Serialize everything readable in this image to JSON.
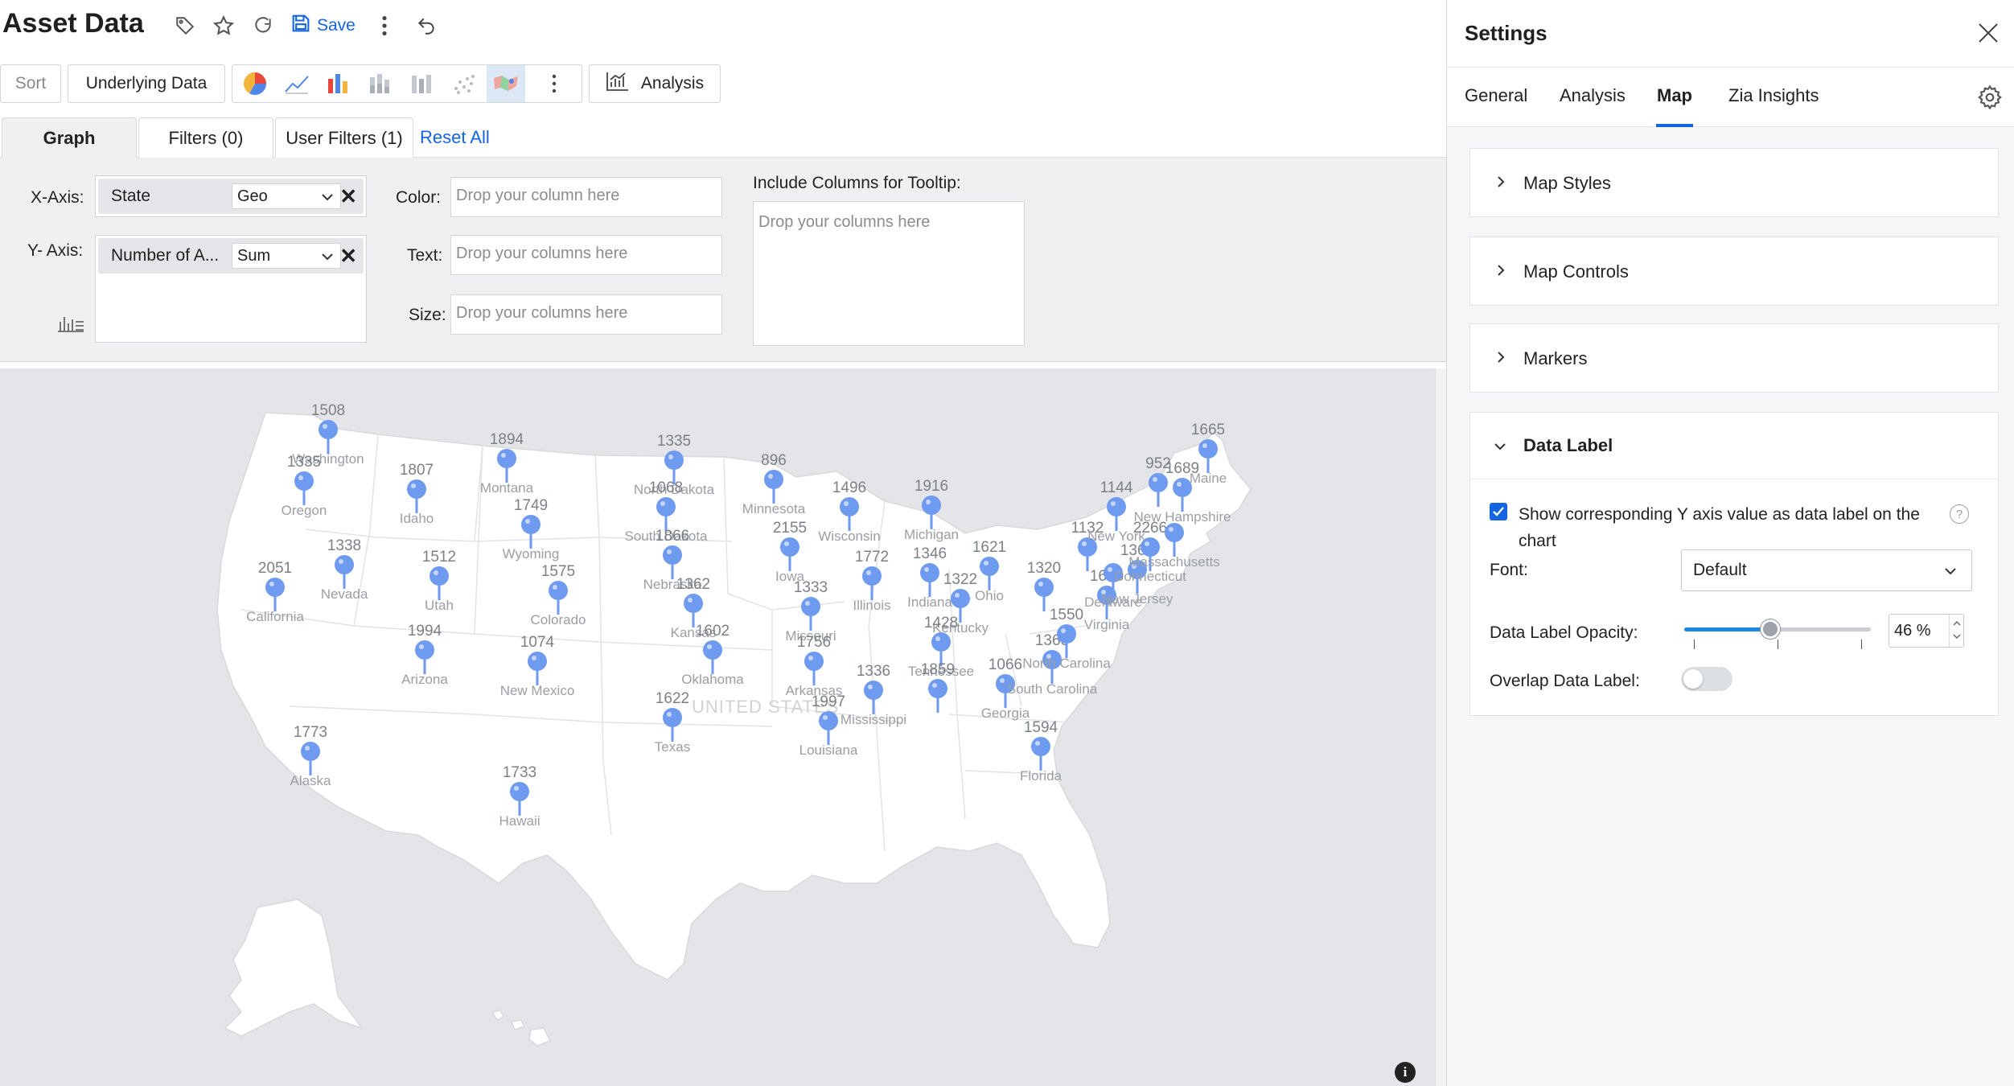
{
  "header": {
    "title": "Asset Data",
    "save_label": "Save"
  },
  "toolbar": {
    "sort_label": "Sort",
    "underlying_label": "Underlying Data",
    "analysis_label": "Analysis",
    "chart_types": [
      "pie-chart",
      "line-chart",
      "bar-chart",
      "stacked-bar-chart",
      "stacked-column-chart",
      "scatter-chart",
      "map-chart"
    ],
    "active_chart_type": "map-chart"
  },
  "tabs": {
    "graph": "Graph",
    "filters": "Filters  (0)",
    "user_filters": "User Filters  (1)",
    "reset_all": "Reset All"
  },
  "config": {
    "x_axis_label": "X-Axis:",
    "x_column": "State",
    "x_function": "Geo",
    "y_axis_label": "Y- Axis:",
    "y_column": "Number of A...",
    "y_function": "Sum",
    "color_label": "Color:",
    "color_placeholder": "Drop your column here",
    "text_label": "Text:",
    "text_placeholder": "Drop your columns here",
    "size_label": "Size:",
    "size_placeholder": "Drop your columns here",
    "tooltip_label": "Include Columns for Tooltip:",
    "tooltip_placeholder": "Drop your columns here"
  },
  "map": {
    "country_label": "UNITED STATES",
    "pin_color": "#6e9af0",
    "markers": [
      {
        "state": "Washington",
        "value": "1508"
      },
      {
        "state": "Oregon",
        "value": "1335"
      },
      {
        "state": "Montana",
        "value": "1894"
      },
      {
        "state": "Idaho",
        "value": "1807"
      },
      {
        "state": "North Dakota",
        "value": "1335"
      },
      {
        "state": "Minnesota",
        "value": "896"
      },
      {
        "state": "Wyoming",
        "value": "1749"
      },
      {
        "state": "South Dakota",
        "value": "1068"
      },
      {
        "state": "Wisconsin",
        "value": "1496"
      },
      {
        "state": "Michigan",
        "value": "1916"
      },
      {
        "state": "Nevada",
        "value": "1338"
      },
      {
        "state": "Utah",
        "value": "1512"
      },
      {
        "state": "California",
        "value": "2051"
      },
      {
        "state": "Colorado",
        "value": "1575"
      },
      {
        "state": "Nebraska",
        "value": "1866"
      },
      {
        "state": "Iowa",
        "value": "2155"
      },
      {
        "state": "Illinois",
        "value": "1772"
      },
      {
        "state": "Indiana",
        "value": "1346"
      },
      {
        "state": "Ohio",
        "value": "1621"
      },
      {
        "state": "Kansas",
        "value": "1362"
      },
      {
        "state": "Missouri",
        "value": "1333"
      },
      {
        "state": "Kentucky",
        "value": "1322"
      },
      {
        "state": "Arizona",
        "value": "1994"
      },
      {
        "state": "New Mexico",
        "value": "1074"
      },
      {
        "state": "Oklahoma",
        "value": "1602"
      },
      {
        "state": "Arkansas",
        "value": "1756"
      },
      {
        "state": "Tennessee",
        "value": "1428"
      },
      {
        "state": "Texas",
        "value": "1622"
      },
      {
        "state": "Mississippi",
        "value": "1336"
      },
      {
        "state": "Louisiana",
        "value": "1997"
      },
      {
        "state": "Alabama",
        "value": "1859"
      },
      {
        "state": "Georgia",
        "value": "1066"
      },
      {
        "state": "South Carolina",
        "value": "1360"
      },
      {
        "state": "North Carolina",
        "value": "1550"
      },
      {
        "state": "Virginia",
        "value": "1650"
      },
      {
        "state": "West Virginia",
        "value": "1320"
      },
      {
        "state": "Pennsylvania",
        "value": "1132"
      },
      {
        "state": "New York",
        "value": "1144"
      },
      {
        "state": "New Jersey",
        "value": "1360"
      },
      {
        "state": "Delaware",
        "value": ""
      },
      {
        "state": "Connecticut",
        "value": "2266"
      },
      {
        "state": "Massachusetts",
        "value": ""
      },
      {
        "state": "Vermont",
        "value": "952"
      },
      {
        "state": "New Hampshire",
        "value": "1689"
      },
      {
        "state": "Maine",
        "value": "1665"
      },
      {
        "state": "Florida",
        "value": "1594"
      },
      {
        "state": "Alaska",
        "value": "1773"
      },
      {
        "state": "Hawaii",
        "value": "1733"
      }
    ]
  },
  "settings": {
    "title": "Settings",
    "tabs": [
      "General",
      "Analysis",
      "Map",
      "Zia Insights"
    ],
    "active_tab": "Map",
    "sections": {
      "map_styles": "Map Styles",
      "map_controls": "Map Controls",
      "markers": "Markers",
      "data_label": "Data Label"
    },
    "data_label": {
      "show_y_value_label": "Show corresponding Y axis value as data label on the chart",
      "show_y_value_checked": true,
      "font_label": "Font:",
      "font_value": "Default",
      "opacity_label": "Data Label Opacity:",
      "opacity_value": "46 %",
      "opacity_fraction": 0.46,
      "overlap_label": "Overlap Data Label:",
      "overlap_on": false
    }
  },
  "colors": {
    "accent": "#1565e0",
    "pin": "#6e9af0",
    "map_land": "#ffffff",
    "map_water": "#e3e5e8"
  }
}
